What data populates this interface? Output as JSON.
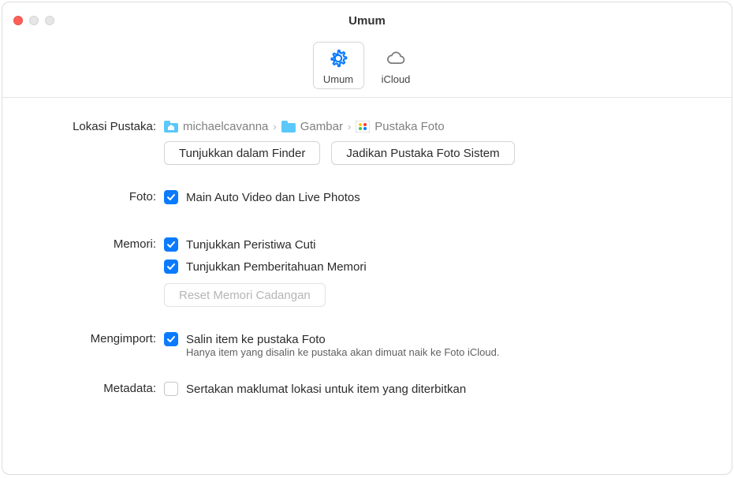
{
  "window": {
    "title": "Umum"
  },
  "tabs": {
    "general": {
      "label": "Umum"
    },
    "icloud": {
      "label": "iCloud"
    }
  },
  "labels": {
    "library_location": "Lokasi Pustaka:",
    "photos": "Foto:",
    "memories": "Memori:",
    "importing": "Mengimport:",
    "metadata": "Metadata:"
  },
  "breadcrumb": {
    "user": "michaelcavanna",
    "folder": "Gambar",
    "library": "Pustaka Foto"
  },
  "buttons": {
    "show_in_finder": "Tunjukkan dalam Finder",
    "use_as_system": "Jadikan Pustaka Foto Sistem",
    "reset_memories": "Reset Memori Cadangan"
  },
  "checkboxes": {
    "autoplay": "Main Auto Video dan Live Photos",
    "holiday_events": "Tunjukkan Peristiwa Cuti",
    "memory_notifications": "Tunjukkan Pemberitahuan Memori",
    "copy_items": "Salin item ke pustaka Foto",
    "copy_items_help": "Hanya item yang disalin ke pustaka akan dimuat naik ke Foto iCloud.",
    "include_location": "Sertakan maklumat lokasi untuk item yang diterbitkan"
  },
  "colors": {
    "accent": "#0a7bff"
  }
}
